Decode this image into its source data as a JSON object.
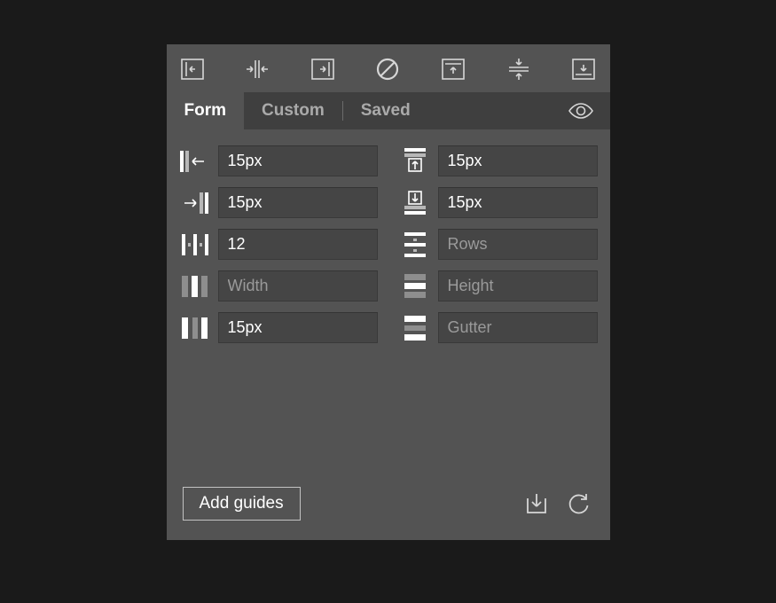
{
  "tabs": {
    "form": "Form",
    "custom": "Custom",
    "saved": "Saved",
    "active": "form"
  },
  "form": {
    "left_margin": {
      "value": "15px"
    },
    "top_margin": {
      "value": "15px"
    },
    "right_margin": {
      "value": "15px"
    },
    "bottom_margin": {
      "value": "15px"
    },
    "columns": {
      "value": "12"
    },
    "rows": {
      "value": "",
      "placeholder": "Rows"
    },
    "col_width": {
      "value": "",
      "placeholder": "Width"
    },
    "row_height": {
      "value": "",
      "placeholder": "Height"
    },
    "col_gutter": {
      "value": "15px"
    },
    "row_gutter": {
      "value": "",
      "placeholder": "Gutter"
    }
  },
  "footer": {
    "add_guides": "Add guides"
  }
}
